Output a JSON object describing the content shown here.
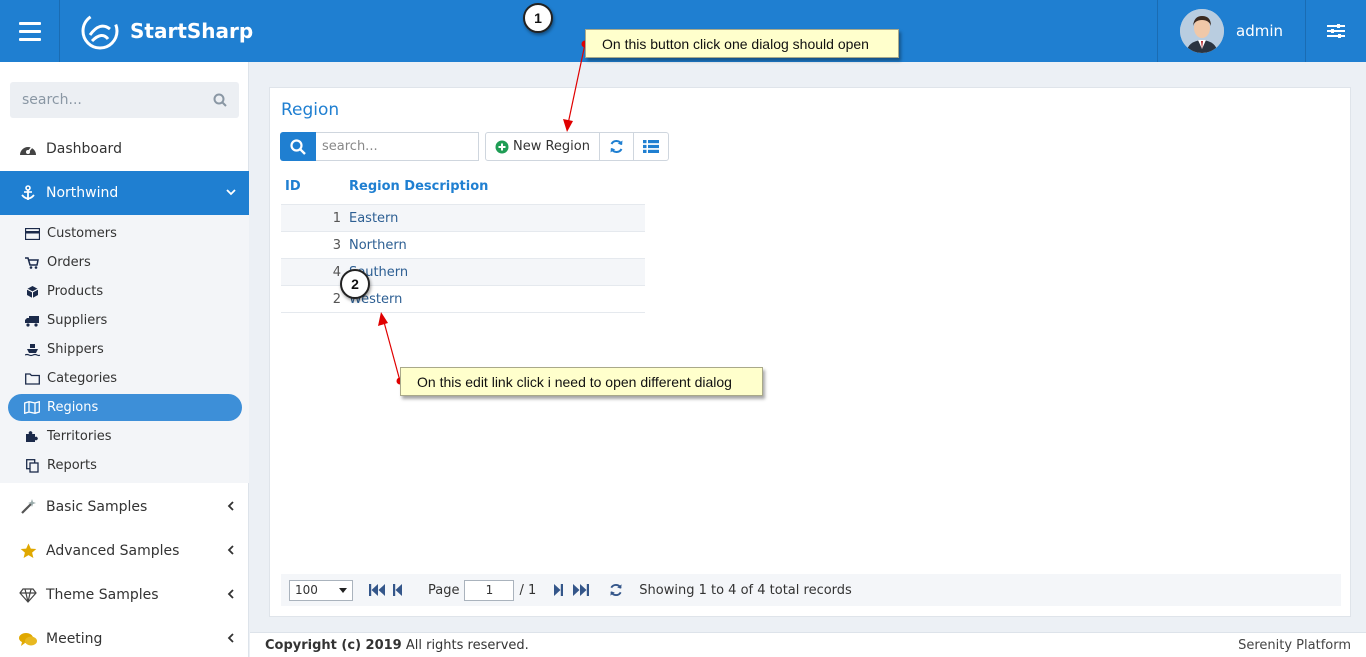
{
  "header": {
    "brand": "StartSharp",
    "user_name": "admin"
  },
  "sidebar": {
    "search_placeholder": "search...",
    "items": [
      {
        "label": "Dashboard",
        "icon": "dashboard-icon"
      },
      {
        "label": "Northwind",
        "icon": "anchor-icon"
      },
      {
        "label": "Basic Samples",
        "icon": "magic-wand-icon"
      },
      {
        "label": "Advanced Samples",
        "icon": "star-icon"
      },
      {
        "label": "Theme Samples",
        "icon": "diamond-icon"
      },
      {
        "label": "Meeting",
        "icon": "comments-icon"
      }
    ],
    "sub_items": [
      {
        "label": "Customers",
        "icon": "credit-card-icon"
      },
      {
        "label": "Orders",
        "icon": "shopping-cart-icon"
      },
      {
        "label": "Products",
        "icon": "cube-icon"
      },
      {
        "label": "Suppliers",
        "icon": "truck-icon"
      },
      {
        "label": "Shippers",
        "icon": "ship-icon"
      },
      {
        "label": "Categories",
        "icon": "folder-icon"
      },
      {
        "label": "Regions",
        "icon": "map-icon"
      },
      {
        "label": "Territories",
        "icon": "puzzle-icon"
      },
      {
        "label": "Reports",
        "icon": "copy-icon"
      }
    ]
  },
  "main": {
    "title": "Region",
    "search_placeholder": "search...",
    "new_button": "New Region",
    "columns": [
      "ID",
      "Region Description"
    ],
    "rows": [
      {
        "id": "1",
        "desc": "Eastern"
      },
      {
        "id": "3",
        "desc": "Northern"
      },
      {
        "id": "4",
        "desc": "Southern"
      },
      {
        "id": "2",
        "desc": "Western"
      }
    ],
    "pager": {
      "page_size": "100",
      "page_label": "Page",
      "page_value": "1",
      "page_total": "/ 1",
      "status": "Showing 1 to 4 of 4 total records"
    }
  },
  "footer": {
    "copyright_bold": "Copyright (c) 2019",
    "copyright_rest": " All rights reserved.",
    "right": "Serenity Platform"
  },
  "annotations": {
    "badge1": "1",
    "badge2": "2",
    "callout1": "On this button click one dialog should open",
    "callout2": "On this edit link click i need to open different dialog"
  },
  "colors": {
    "brand_blue": "#1f7fd1",
    "callout_bg": "#ffffcc",
    "arrow_red": "#e00000"
  }
}
